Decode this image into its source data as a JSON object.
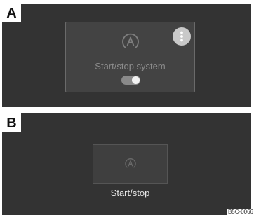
{
  "panel_a": {
    "tag": "A",
    "tile": {
      "icon": "auto-start-stop-icon",
      "menu_icon": "more-vertical-icon",
      "label": "Start/stop system",
      "toggle_on": true
    }
  },
  "panel_b": {
    "tag": "B",
    "tile": {
      "icon": "auto-start-stop-icon",
      "label": "Start/stop"
    }
  },
  "reference_code": "B5C-0066",
  "colors": {
    "panel_background": "#333333",
    "tile_background": "#434343",
    "more_button": "#c9c9c9",
    "toggle_track": "#8a8a8a",
    "toggle_knob": "#f2f2f2"
  }
}
